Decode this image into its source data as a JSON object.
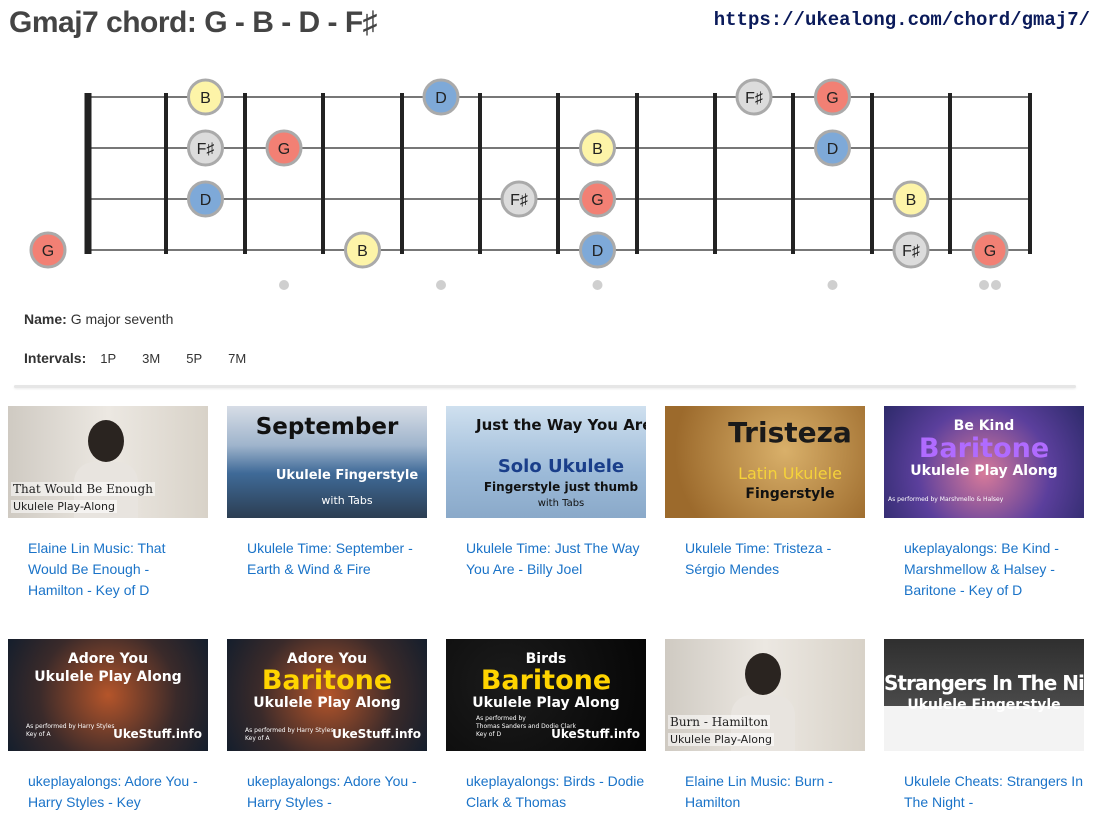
{
  "header": {
    "title": "Gmaj7 chord: G - B - D - F♯",
    "url": "https://ukealong.com/chord/gmaj7/"
  },
  "fretboard": {
    "note_colors": {
      "G": "#f28074",
      "B": "#fdf4a8",
      "D": "#7ea9d8",
      "F♯": "#dcdcdc"
    },
    "string_order_top_to_bottom": [
      "A",
      "E",
      "C",
      "G"
    ],
    "notes": [
      {
        "string": 0,
        "fret": 2,
        "label": "B"
      },
      {
        "string": 0,
        "fret": 5,
        "label": "D"
      },
      {
        "string": 0,
        "fret": 9,
        "label": "F♯"
      },
      {
        "string": 0,
        "fret": 10,
        "label": "G"
      },
      {
        "string": 1,
        "fret": 2,
        "label": "F♯"
      },
      {
        "string": 1,
        "fret": 3,
        "label": "G"
      },
      {
        "string": 1,
        "fret": 7,
        "label": "B"
      },
      {
        "string": 1,
        "fret": 10,
        "label": "D"
      },
      {
        "string": 2,
        "fret": 2,
        "label": "D"
      },
      {
        "string": 2,
        "fret": 6,
        "label": "F♯"
      },
      {
        "string": 2,
        "fret": 7,
        "label": "G"
      },
      {
        "string": 2,
        "fret": 11,
        "label": "B"
      },
      {
        "string": 3,
        "fret": 0,
        "label": "G"
      },
      {
        "string": 3,
        "fret": 4,
        "label": "B"
      },
      {
        "string": 3,
        "fret": 7,
        "label": "D"
      },
      {
        "string": 3,
        "fret": 11,
        "label": "F♯"
      },
      {
        "string": 3,
        "fret": 12,
        "label": "G"
      }
    ],
    "position_markers": [
      3,
      5,
      7,
      10,
      12
    ]
  },
  "chord_info": {
    "name_label": "Name:",
    "name_value": "G major seventh",
    "intervals_label": "Intervals:",
    "intervals": [
      "1P",
      "3M",
      "5P",
      "7M"
    ]
  },
  "videos": [
    {
      "caption": "Elaine Lin Music: That Would Be Enough - Hamilton - Key of D",
      "thumb": {
        "style": "photo-light",
        "bg": "#d9d4cc",
        "lines": [
          "That Would Be Enough",
          "Ukulele Play-Along"
        ]
      }
    },
    {
      "caption": "Ukulele Time: September - Earth & Wind & Fire",
      "thumb": {
        "style": "sea",
        "bg": "#5d7fa6",
        "lines": [
          "September",
          "Ukulele Fingerstyle",
          "with Tabs"
        ]
      }
    },
    {
      "caption": "Ukulele Time: Just The Way You Are - Billy Joel",
      "thumb": {
        "style": "sky",
        "bg": "#b9d2e8",
        "lines": [
          "Just the Way You Are",
          "Solo Ukulele",
          "Fingerstyle just thumb",
          "with Tabs"
        ]
      }
    },
    {
      "caption": "Ukulele Time: Tristeza - Sérgio Mendes",
      "thumb": {
        "style": "parchment",
        "bg": "#b98a45",
        "lines": [
          "Tristeza",
          "Latin Ukulele",
          "Fingerstyle"
        ]
      }
    },
    {
      "caption": "ukeplayalongs: Be Kind - Marshmellow & Halsey - Baritone - Key of D",
      "thumb": {
        "style": "purple",
        "bg": "#5a4a9a",
        "lines": [
          "Be Kind",
          "Baritone",
          "Ukulele Play Along",
          "As performed by Marshmello & Halsey"
        ]
      }
    },
    {
      "caption": "ukeplayalongs: Adore You - Harry Styles - Key",
      "thumb": {
        "style": "dark-orange",
        "bg": "#1d2a3a",
        "lines": [
          "Adore You",
          "Ukulele Play Along",
          "As performed by Harry Styles",
          "Key of A",
          "UkeStuff.info"
        ]
      }
    },
    {
      "caption": "ukeplayalongs: Adore You - Harry Styles -",
      "thumb": {
        "style": "dark-orange",
        "bg": "#1d2a3a",
        "lines": [
          "Adore You",
          "Baritone",
          "Ukulele Play Along",
          "As performed by Harry Styles",
          "Key of A",
          "UkeStuff.info"
        ]
      }
    },
    {
      "caption": "ukeplayalongs: Birds - Dodie Clark & Thomas",
      "thumb": {
        "style": "black",
        "bg": "#0c0c0c",
        "lines": [
          "Birds",
          "Baritone",
          "Ukulele Play Along",
          "As performed by",
          "Thomas Sanders and Dodie Clark",
          "Key of D",
          "UkeStuff.info"
        ]
      }
    },
    {
      "caption": "Elaine Lin Music: Burn - Hamilton",
      "thumb": {
        "style": "photo-light",
        "bg": "#d6d3cf",
        "lines": [
          "Burn - Hamilton",
          "Ukulele Play-Along"
        ]
      }
    },
    {
      "caption": "Ukulele Cheats: Strangers In The Night -",
      "thumb": {
        "style": "tab",
        "bg": "#3a3a3a",
        "lines": [
          "Strangers In The Night",
          "Ukulele Fingerstyle"
        ]
      }
    }
  ]
}
